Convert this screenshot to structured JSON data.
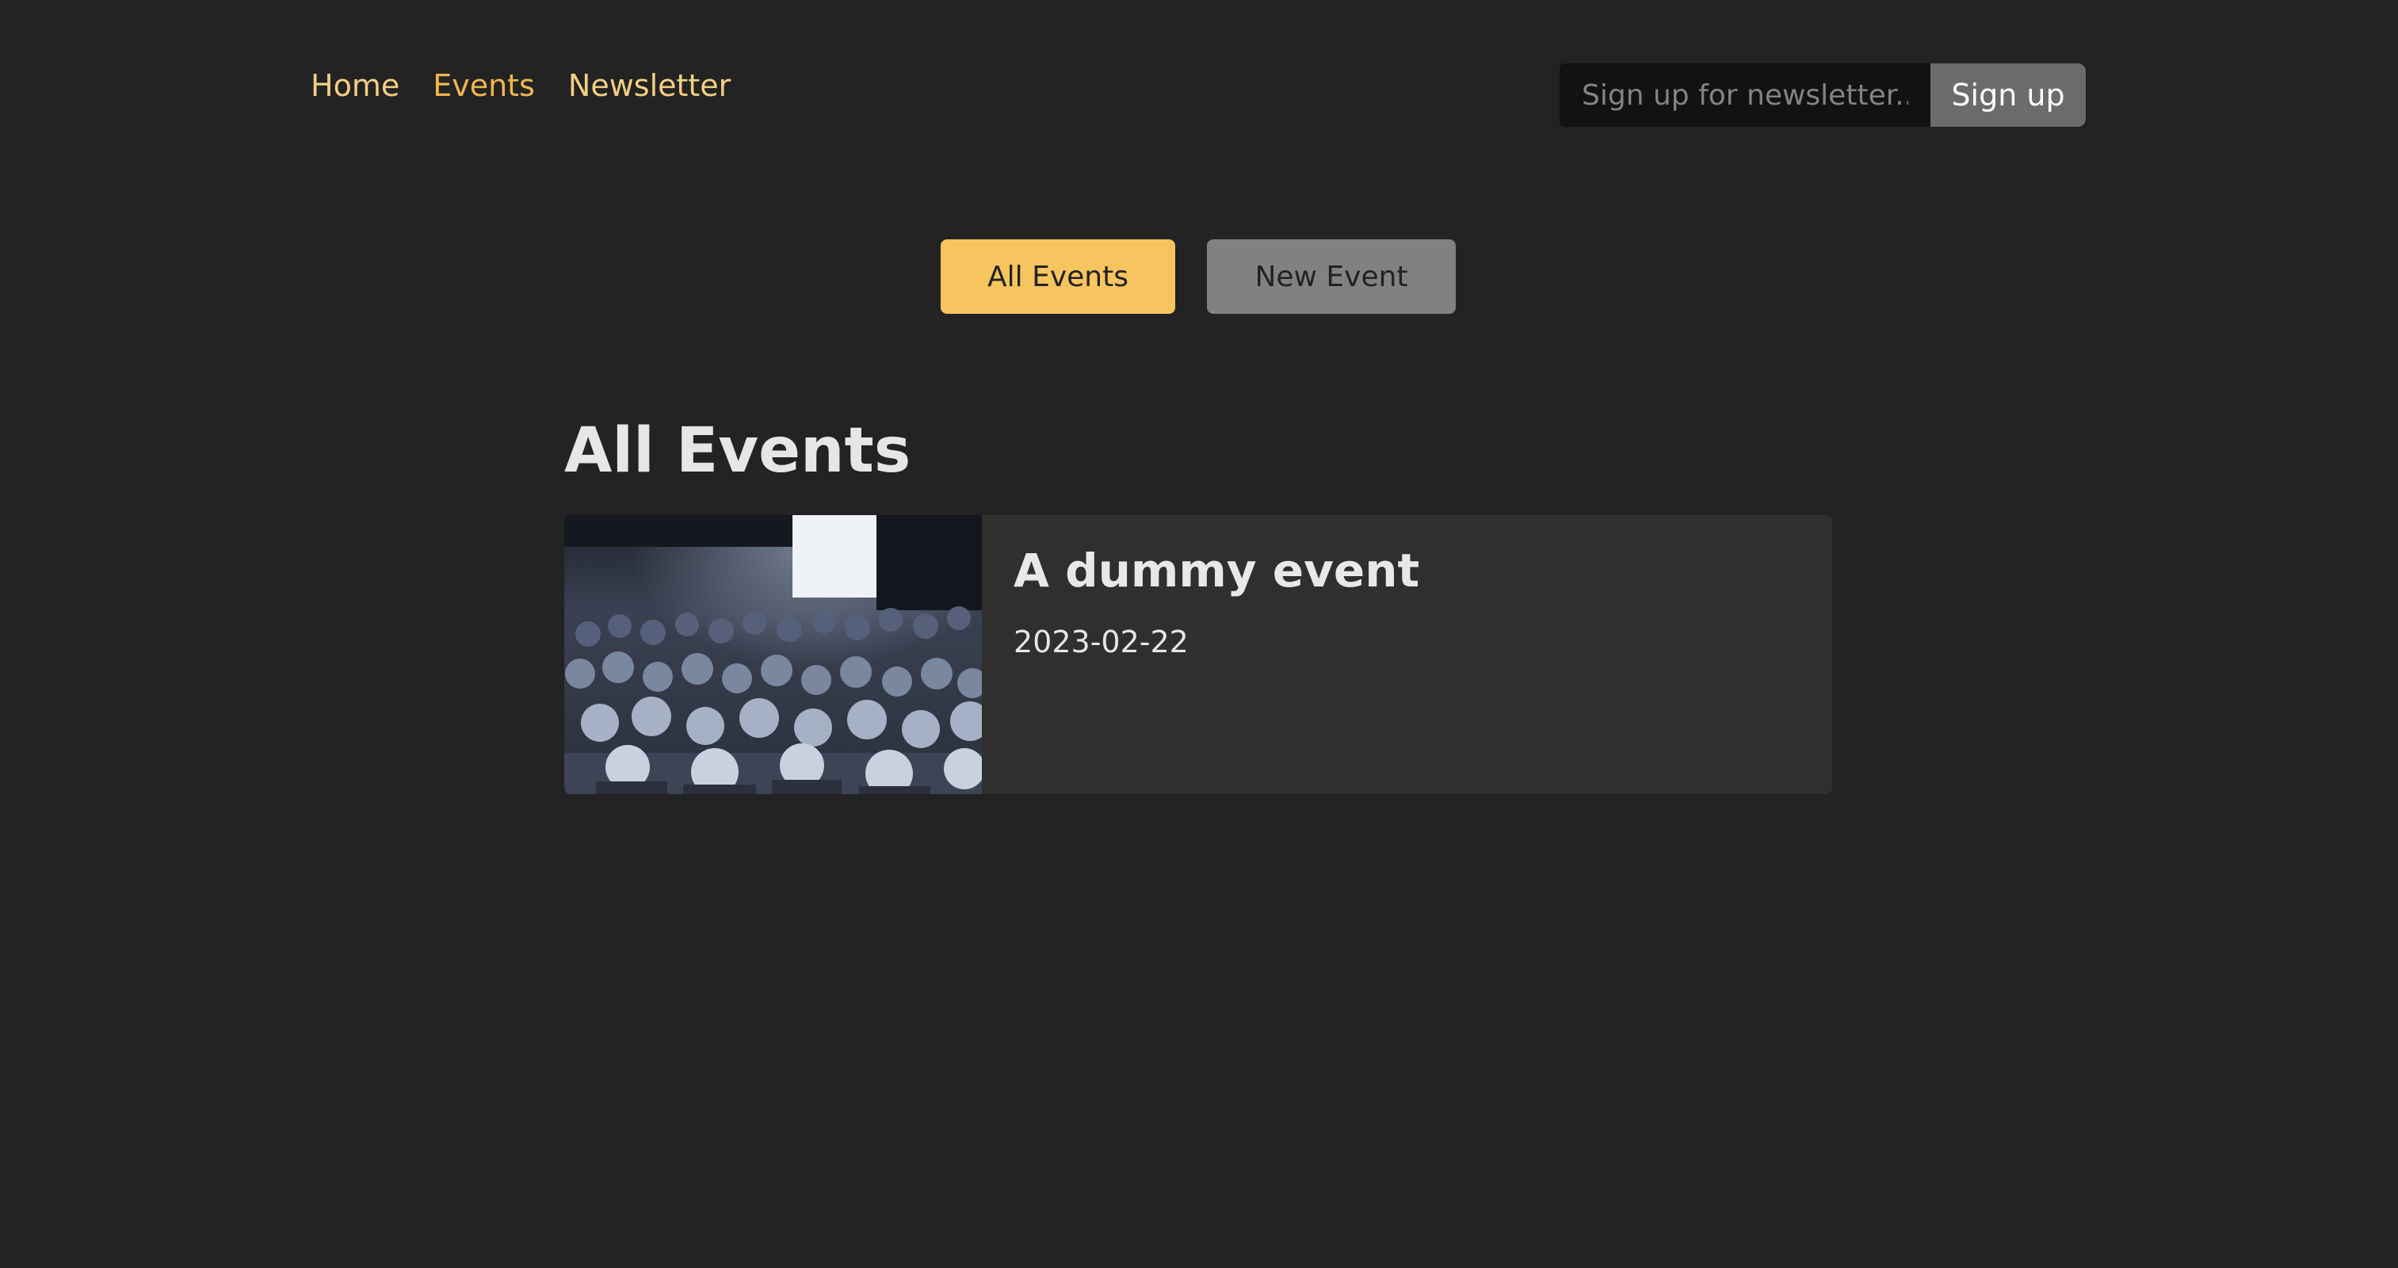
{
  "nav": {
    "items": [
      {
        "label": "Home",
        "active": false
      },
      {
        "label": "Events",
        "active": true
      },
      {
        "label": "Newsletter",
        "active": false
      }
    ]
  },
  "newsletter": {
    "placeholder": "Sign up for newsletter..",
    "value": "",
    "button_label": "Sign up"
  },
  "events_nav": {
    "all_events_label": "All Events",
    "new_event_label": "New Event"
  },
  "events": {
    "heading": "All Events",
    "items": [
      {
        "title": "A dummy event",
        "date": "2023-02-22",
        "image": "conference-audience-photo"
      }
    ]
  },
  "colors": {
    "background": "#232323",
    "accent": "#f6c55f",
    "nav_link": "#f3cf83",
    "nav_link_active": "#f0b64e",
    "card_background": "#312f2d"
  }
}
